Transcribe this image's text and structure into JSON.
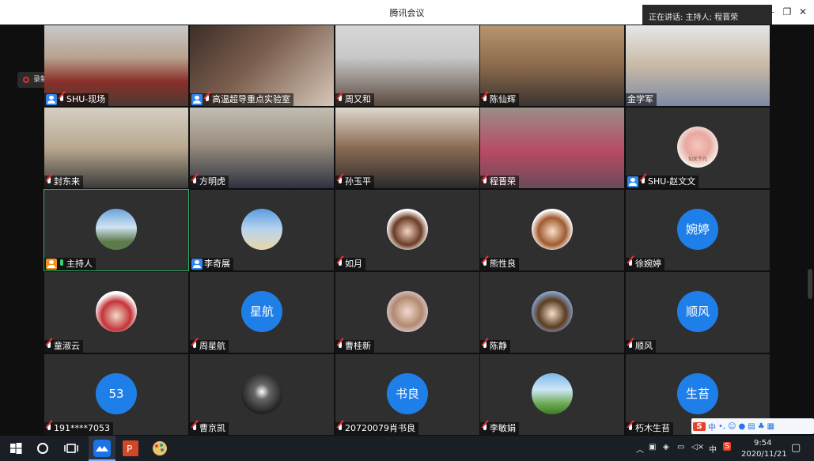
{
  "window": {
    "title": "腾讯会议"
  },
  "speaking_now": "正在讲话: 主持人; 程晋荣",
  "recording_label": "录制中",
  "participants": [
    {
      "name": "SHU-现场",
      "role": "member",
      "mic": "muted"
    },
    {
      "name": "高温超导重点实验室",
      "role": "member",
      "mic": "muted"
    },
    {
      "name": "周又和",
      "role": "none",
      "mic": "muted"
    },
    {
      "name": "陈仙辉",
      "role": "none",
      "mic": "muted"
    },
    {
      "name": "金学军",
      "role": "none",
      "mic": "none"
    },
    {
      "name": "封东来",
      "role": "none",
      "mic": "muted"
    },
    {
      "name": "方明虎",
      "role": "none",
      "mic": "muted"
    },
    {
      "name": "孙玉平",
      "role": "none",
      "mic": "muted"
    },
    {
      "name": "程晋荣",
      "role": "none",
      "mic": "muted"
    },
    {
      "name": "SHU-赵文文",
      "role": "member",
      "mic": "muted",
      "avatar_text": "仙女下凡"
    },
    {
      "name": "主持人",
      "role": "host",
      "mic": "on"
    },
    {
      "name": "李奇展",
      "role": "member",
      "mic": "none"
    },
    {
      "name": "如月",
      "role": "none",
      "mic": "muted"
    },
    {
      "name": "熊性良",
      "role": "none",
      "mic": "muted"
    },
    {
      "name": "徐婉婷",
      "role": "none",
      "mic": "muted",
      "avatar_text": "婉婷"
    },
    {
      "name": "童淑云",
      "role": "none",
      "mic": "muted"
    },
    {
      "name": "周星航",
      "role": "none",
      "mic": "muted",
      "avatar_text": "星航"
    },
    {
      "name": "曹桂新",
      "role": "none",
      "mic": "muted"
    },
    {
      "name": "陈静",
      "role": "none",
      "mic": "muted"
    },
    {
      "name": "顺风",
      "role": "none",
      "mic": "muted",
      "avatar_text": "顺风"
    },
    {
      "name": "191****7053",
      "role": "none",
      "mic": "muted",
      "avatar_text": "53"
    },
    {
      "name": "曹京凯",
      "role": "none",
      "mic": "muted"
    },
    {
      "name": "20720079肖书良",
      "role": "none",
      "mic": "muted",
      "avatar_text": "书良"
    },
    {
      "name": "李敏娟",
      "role": "none",
      "mic": "muted"
    },
    {
      "name": "朽木生苔",
      "role": "none",
      "mic": "muted",
      "avatar_text": "生苔"
    }
  ],
  "ime_bar": {
    "mode": "中"
  },
  "taskbar": {
    "time": "9:54",
    "date": "2020/11/21",
    "lang": "中"
  },
  "colors": {
    "accent": "#1f7fe8",
    "host": "#f0901e",
    "active_border": "#29b364"
  }
}
